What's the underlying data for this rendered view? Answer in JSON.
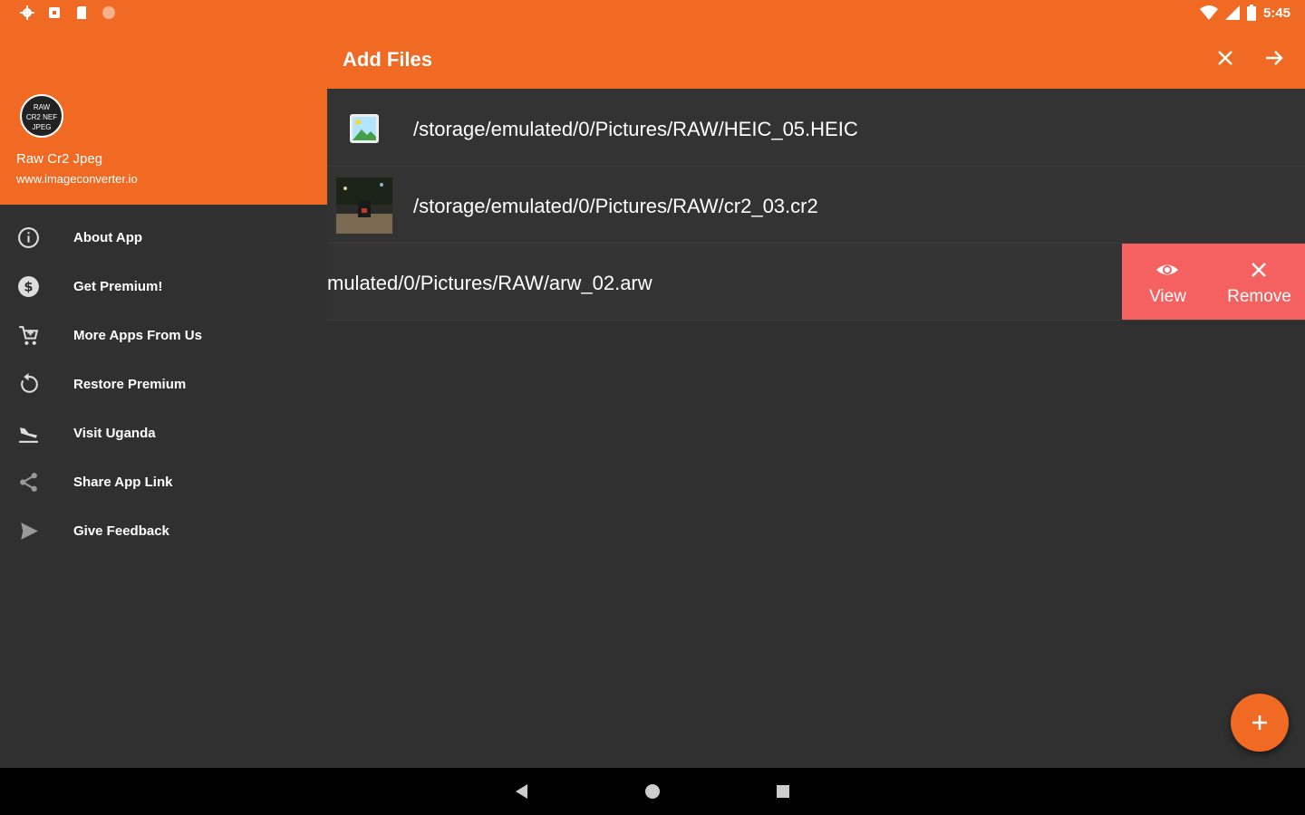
{
  "status_bar": {
    "time": "5:45",
    "left_icons": [
      "gear-icon",
      "notification-icon",
      "sd-card-icon",
      "circle-icon"
    ],
    "right_icons": [
      "wifi-icon",
      "signal-icon",
      "battery-icon"
    ]
  },
  "drawer": {
    "logo_text": [
      "RAW",
      "CR2 NEF",
      "JPEG"
    ],
    "app_name": "Raw Cr2 Jpeg",
    "website": "www.imageconverter.io",
    "items": [
      {
        "label": "About App",
        "icon": "info-icon"
      },
      {
        "label": "Get Premium!",
        "icon": "dollar-icon"
      },
      {
        "label": "More Apps From Us",
        "icon": "cart-icon"
      },
      {
        "label": "Restore Premium",
        "icon": "restore-icon"
      },
      {
        "label": "Visit Uganda",
        "icon": "plane-landing-icon"
      },
      {
        "label": "Share App Link",
        "icon": "share-icon"
      },
      {
        "label": "Give Feedback",
        "icon": "send-icon"
      }
    ]
  },
  "app_bar": {
    "title": "Add Files",
    "actions": [
      "close-icon",
      "arrow-forward-icon"
    ]
  },
  "files": [
    {
      "path": "/storage/emulated/0/Pictures/RAW/HEIC_05.HEIC",
      "thumb": "image-placeholder-icon"
    },
    {
      "path": "/storage/emulated/0/Pictures/RAW/cr2_03.cr2",
      "thumb": "photo-thumbnail"
    },
    {
      "path": "mulated/0/Pictures/RAW/arw_02.arw",
      "thumb": ""
    }
  ],
  "swipe_actions": {
    "view_label": "View",
    "remove_label": "Remove",
    "color": "#f56060"
  },
  "fab": {
    "icon": "plus-icon"
  },
  "colors": {
    "primary": "#f06a23",
    "background": "#303030",
    "row": "#333333"
  }
}
